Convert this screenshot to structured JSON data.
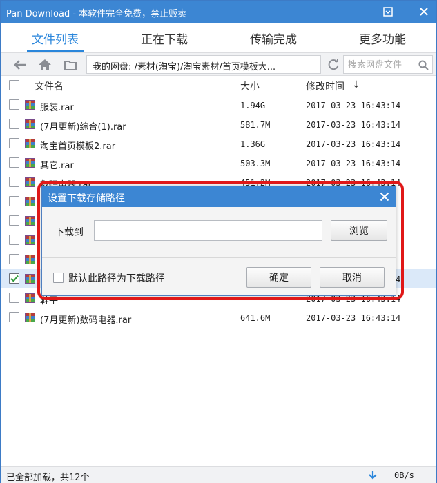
{
  "window": {
    "title": "Pan Download - 本软件完全免费，禁止贩卖",
    "colors": {
      "titlebar": "#3c86d3",
      "accent": "#2a86db",
      "highlight": "#e01818"
    }
  },
  "tabs": [
    {
      "label": "文件列表",
      "active": true
    },
    {
      "label": "正在下载",
      "active": false
    },
    {
      "label": "传输完成",
      "active": false
    },
    {
      "label": "更多功能",
      "active": false
    }
  ],
  "navbar": {
    "path": "我的网盘: /素材(淘宝)/淘宝素材/首页模板大...",
    "search_placeholder": "搜索网盘文件"
  },
  "table": {
    "headers": {
      "name": "文件名",
      "size": "大小",
      "date": "修改时间",
      "sort_icon": "↓"
    },
    "rows": [
      {
        "name": "服装.rar",
        "size": "1.94G",
        "date": "2017-03-23 16:43:14",
        "checked": false
      },
      {
        "name": "(7月更新)综合(1).rar",
        "size": "581.7M",
        "date": "2017-03-23 16:43:14",
        "checked": false
      },
      {
        "name": "淘宝首页模板2.rar",
        "size": "1.36G",
        "date": "2017-03-23 16:43:14",
        "checked": false
      },
      {
        "name": "其它.rar",
        "size": "503.3M",
        "date": "2017-03-23 16:43:14",
        "checked": false
      },
      {
        "name": "数码电器.rar",
        "size": "451.2M",
        "date": "2017-03-23 16:43:14",
        "checked": false
      },
      {
        "name": "",
        "size": "",
        "date": "",
        "checked": false
      },
      {
        "name": "",
        "size": "",
        "date": "",
        "checked": false
      },
      {
        "name": "",
        "size": "",
        "date": "",
        "checked": false
      },
      {
        "name": "",
        "size": "",
        "date": "",
        "checked": false
      },
      {
        "name": "",
        "size": "",
        "date": "2017-03-23 16:43:14",
        "checked": true
      },
      {
        "name": "鞋子",
        "size": "",
        "date": "2017-03-23 16:43:14",
        "checked": false
      },
      {
        "name": "(7月更新)数码电器.rar",
        "size": "641.6M",
        "date": "2017-03-23 16:43:14",
        "checked": false
      }
    ]
  },
  "dialog": {
    "title": "设置下载存储路径",
    "download_to_label": "下载到",
    "path_value": "",
    "browse_label": "浏览",
    "default_checkbox_label": "默认此路径为下载路径",
    "ok_label": "确定",
    "cancel_label": "取消"
  },
  "status": {
    "text": "已全部加载，共12个",
    "speed": "0B/s"
  }
}
